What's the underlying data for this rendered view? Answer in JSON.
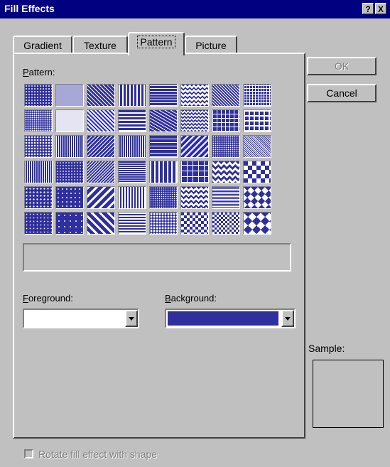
{
  "window": {
    "title": "Fill Effects",
    "help_button": "?",
    "close_button": "X"
  },
  "tabs": [
    {
      "label": "Gradient",
      "active": false
    },
    {
      "label": "Texture",
      "active": false
    },
    {
      "label": "Pattern",
      "active": true
    },
    {
      "label": "Picture",
      "active": false
    }
  ],
  "pattern_section": {
    "label": "Pattern:",
    "selected_description": "",
    "pattern_count": 48
  },
  "foreground": {
    "label": "Foreground:",
    "color": "#ffffff"
  },
  "background": {
    "label": "Background:",
    "color": "#2f2f9e"
  },
  "buttons": {
    "ok_label": "OK",
    "ok_enabled": false,
    "cancel_label": "Cancel"
  },
  "sample": {
    "label": "Sample:"
  },
  "rotate_option": {
    "label": "Rotate fill effect with shape",
    "checked": false,
    "enabled": false
  },
  "colors": {
    "title_bar": "#000080",
    "dialog_face": "#c0c0c0",
    "pattern_fg": "#ffffff",
    "pattern_bg": "#2f2f9e"
  }
}
